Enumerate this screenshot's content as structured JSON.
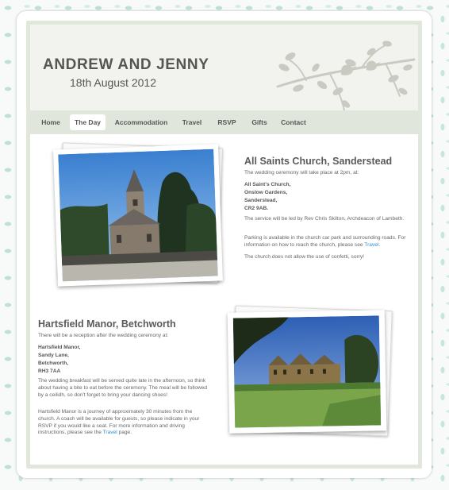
{
  "header": {
    "title": "ANDREW AND JENNY",
    "date": "18th August 2012"
  },
  "nav": {
    "items": [
      {
        "label": "Home"
      },
      {
        "label": "The Day"
      },
      {
        "label": "Accommodation"
      },
      {
        "label": "Travel"
      },
      {
        "label": "RSVP"
      },
      {
        "label": "Gifts"
      },
      {
        "label": "Contact"
      }
    ],
    "active": "The Day"
  },
  "church": {
    "title": "All Saints Church, Sanderstead",
    "intro": "The wedding ceremony will take place at 2pm, at:",
    "address": [
      "All Saint's Church,",
      "Onslow Gardens,",
      "Sanderstead,",
      "CR2 9AB."
    ],
    "led_by": "The service will be led by Rev Chris Skilton, Archdeacon of Lambeth.",
    "parking_before": "Parking is available in the church car park and surrounding roads. For information on how to reach the church, please see",
    "parking_link": "Travel",
    "parking_after": ".",
    "confetti": "The church does not allow the use of confetti, sorry!"
  },
  "manor": {
    "title": "Hartsfield Manor, Betchworth",
    "intro": "There will be a reception after the wedding ceremony at:",
    "address": [
      "Hartsfield Manor,",
      "Sandy Lane,",
      "Betchworth,",
      "RH3 7AA"
    ],
    "breakfast": "The wedding breakfast will be served quite late in the afternoon, so think about having a bite to eat before the ceremony. The meal will be followed by a ceilidh, so don't forget to bring your dancing shoes!",
    "journey_before": "Hartsfield Manor is a journey of approximately 30 minutes from the church. A coach will be available for guests, so please indicate in your RSVP if you would like a seat. For more information and driving instructions, please see the",
    "journey_link": "Travel",
    "journey_after": "page."
  },
  "colors": {
    "accent": "#2b8fd0",
    "header_bg": "#f2f3ee",
    "nav_bg": "#e1e6dc",
    "leaf_pattern": "#bfe0d6"
  }
}
